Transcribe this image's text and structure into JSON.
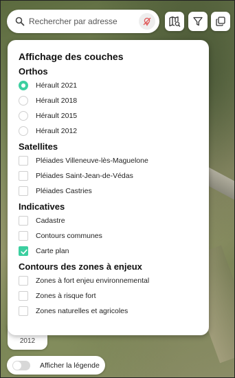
{
  "search": {
    "placeholder": "Rechercher par adresse"
  },
  "toolbar": {
    "icons": [
      "search-icon",
      "location-off-icon",
      "map-search-icon",
      "filter-icon",
      "layers-icon"
    ],
    "location_off_color": "#e05a5a"
  },
  "panel": {
    "title": "Affichage des couches",
    "sections": {
      "orthos": {
        "title": "Orthos",
        "options": [
          {
            "label": "Hérault 2021",
            "selected": true
          },
          {
            "label": "Hérault 2018",
            "selected": false
          },
          {
            "label": "Hérault 2015",
            "selected": false
          },
          {
            "label": "Hérault 2012",
            "selected": false
          }
        ]
      },
      "satellites": {
        "title": "Satellites",
        "options": [
          {
            "label": "Pléiades Villeneuve-lès-Maguelone",
            "checked": false
          },
          {
            "label": "Pléiades Saint-Jean-de-Védas",
            "checked": false
          },
          {
            "label": "Pléiades Castries",
            "checked": false
          }
        ]
      },
      "indicatives": {
        "title": "Indicatives",
        "options": [
          {
            "label": "Cadastre",
            "checked": false
          },
          {
            "label": "Contours communes",
            "checked": false
          },
          {
            "label": "Carte plan",
            "checked": true
          }
        ]
      },
      "contours": {
        "title": "Contours des zones à enjeux",
        "options": [
          {
            "label": "Zones à fort enjeu environnemental",
            "checked": false
          },
          {
            "label": "Zones à risque fort",
            "checked": false
          },
          {
            "label": "Zones naturelles et agricoles",
            "checked": false
          }
        ]
      }
    }
  },
  "year_card": {
    "label": "2012"
  },
  "legend": {
    "label": "Afficher la légende",
    "enabled": false
  },
  "colors": {
    "accent": "#3ccfa0"
  }
}
